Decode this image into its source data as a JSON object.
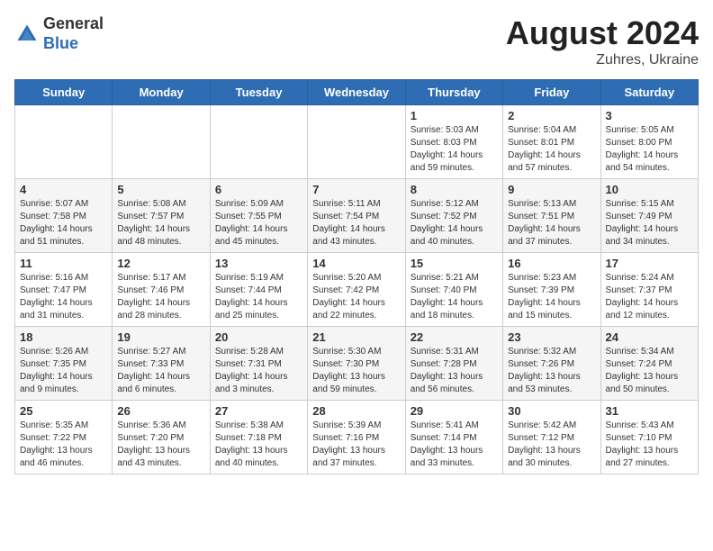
{
  "header": {
    "logo_general": "General",
    "logo_blue": "Blue",
    "title": "August 2024",
    "subtitle": "Zuhres, Ukraine"
  },
  "days_of_week": [
    "Sunday",
    "Monday",
    "Tuesday",
    "Wednesday",
    "Thursday",
    "Friday",
    "Saturday"
  ],
  "weeks": [
    [
      {
        "day": "",
        "info": ""
      },
      {
        "day": "",
        "info": ""
      },
      {
        "day": "",
        "info": ""
      },
      {
        "day": "",
        "info": ""
      },
      {
        "day": "1",
        "info": "Sunrise: 5:03 AM\nSunset: 8:03 PM\nDaylight: 14 hours\nand 59 minutes."
      },
      {
        "day": "2",
        "info": "Sunrise: 5:04 AM\nSunset: 8:01 PM\nDaylight: 14 hours\nand 57 minutes."
      },
      {
        "day": "3",
        "info": "Sunrise: 5:05 AM\nSunset: 8:00 PM\nDaylight: 14 hours\nand 54 minutes."
      }
    ],
    [
      {
        "day": "4",
        "info": "Sunrise: 5:07 AM\nSunset: 7:58 PM\nDaylight: 14 hours\nand 51 minutes."
      },
      {
        "day": "5",
        "info": "Sunrise: 5:08 AM\nSunset: 7:57 PM\nDaylight: 14 hours\nand 48 minutes."
      },
      {
        "day": "6",
        "info": "Sunrise: 5:09 AM\nSunset: 7:55 PM\nDaylight: 14 hours\nand 45 minutes."
      },
      {
        "day": "7",
        "info": "Sunrise: 5:11 AM\nSunset: 7:54 PM\nDaylight: 14 hours\nand 43 minutes."
      },
      {
        "day": "8",
        "info": "Sunrise: 5:12 AM\nSunset: 7:52 PM\nDaylight: 14 hours\nand 40 minutes."
      },
      {
        "day": "9",
        "info": "Sunrise: 5:13 AM\nSunset: 7:51 PM\nDaylight: 14 hours\nand 37 minutes."
      },
      {
        "day": "10",
        "info": "Sunrise: 5:15 AM\nSunset: 7:49 PM\nDaylight: 14 hours\nand 34 minutes."
      }
    ],
    [
      {
        "day": "11",
        "info": "Sunrise: 5:16 AM\nSunset: 7:47 PM\nDaylight: 14 hours\nand 31 minutes."
      },
      {
        "day": "12",
        "info": "Sunrise: 5:17 AM\nSunset: 7:46 PM\nDaylight: 14 hours\nand 28 minutes."
      },
      {
        "day": "13",
        "info": "Sunrise: 5:19 AM\nSunset: 7:44 PM\nDaylight: 14 hours\nand 25 minutes."
      },
      {
        "day": "14",
        "info": "Sunrise: 5:20 AM\nSunset: 7:42 PM\nDaylight: 14 hours\nand 22 minutes."
      },
      {
        "day": "15",
        "info": "Sunrise: 5:21 AM\nSunset: 7:40 PM\nDaylight: 14 hours\nand 18 minutes."
      },
      {
        "day": "16",
        "info": "Sunrise: 5:23 AM\nSunset: 7:39 PM\nDaylight: 14 hours\nand 15 minutes."
      },
      {
        "day": "17",
        "info": "Sunrise: 5:24 AM\nSunset: 7:37 PM\nDaylight: 14 hours\nand 12 minutes."
      }
    ],
    [
      {
        "day": "18",
        "info": "Sunrise: 5:26 AM\nSunset: 7:35 PM\nDaylight: 14 hours\nand 9 minutes."
      },
      {
        "day": "19",
        "info": "Sunrise: 5:27 AM\nSunset: 7:33 PM\nDaylight: 14 hours\nand 6 minutes."
      },
      {
        "day": "20",
        "info": "Sunrise: 5:28 AM\nSunset: 7:31 PM\nDaylight: 14 hours\nand 3 minutes."
      },
      {
        "day": "21",
        "info": "Sunrise: 5:30 AM\nSunset: 7:30 PM\nDaylight: 13 hours\nand 59 minutes."
      },
      {
        "day": "22",
        "info": "Sunrise: 5:31 AM\nSunset: 7:28 PM\nDaylight: 13 hours\nand 56 minutes."
      },
      {
        "day": "23",
        "info": "Sunrise: 5:32 AM\nSunset: 7:26 PM\nDaylight: 13 hours\nand 53 minutes."
      },
      {
        "day": "24",
        "info": "Sunrise: 5:34 AM\nSunset: 7:24 PM\nDaylight: 13 hours\nand 50 minutes."
      }
    ],
    [
      {
        "day": "25",
        "info": "Sunrise: 5:35 AM\nSunset: 7:22 PM\nDaylight: 13 hours\nand 46 minutes."
      },
      {
        "day": "26",
        "info": "Sunrise: 5:36 AM\nSunset: 7:20 PM\nDaylight: 13 hours\nand 43 minutes."
      },
      {
        "day": "27",
        "info": "Sunrise: 5:38 AM\nSunset: 7:18 PM\nDaylight: 13 hours\nand 40 minutes."
      },
      {
        "day": "28",
        "info": "Sunrise: 5:39 AM\nSunset: 7:16 PM\nDaylight: 13 hours\nand 37 minutes."
      },
      {
        "day": "29",
        "info": "Sunrise: 5:41 AM\nSunset: 7:14 PM\nDaylight: 13 hours\nand 33 minutes."
      },
      {
        "day": "30",
        "info": "Sunrise: 5:42 AM\nSunset: 7:12 PM\nDaylight: 13 hours\nand 30 minutes."
      },
      {
        "day": "31",
        "info": "Sunrise: 5:43 AM\nSunset: 7:10 PM\nDaylight: 13 hours\nand 27 minutes."
      }
    ]
  ]
}
